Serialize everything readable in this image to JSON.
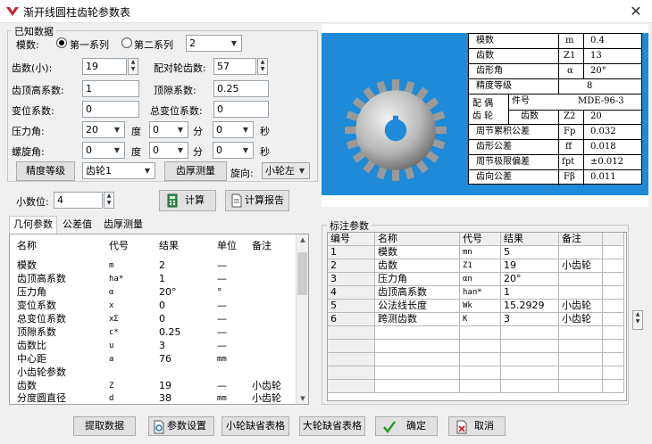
{
  "window": {
    "title": "渐开线圆柱齿轮参数表",
    "close_glyph": "✕"
  },
  "known": {
    "group_label": "已知数据",
    "modulus_label": "模数:",
    "series1_label": "第一系列",
    "series2_label": "第二系列",
    "modulus_value": "2",
    "teeth_label": "齿数(小):",
    "teeth_value": "19",
    "mating_teeth_label": "配对轮齿数:",
    "mating_teeth_value": "57",
    "addendum_label": "齿顶高系数:",
    "addendum_value": "1",
    "clearance_label": "顶隙系数:",
    "clearance_value": "0.25",
    "shift_label": "变位系数:",
    "shift_value": "0",
    "total_shift_label": "总变位系数:",
    "total_shift_value": "0",
    "pressure_label": "压力角:",
    "pressure_deg": "20",
    "pressure_min": "0",
    "pressure_sec": "0",
    "helix_label": "螺旋角:",
    "helix_deg": "0",
    "helix_min": "0",
    "helix_sec": "0",
    "unit_deg": "度",
    "unit_min": "分",
    "unit_sec": "秒",
    "precision_button": "精度等级",
    "gear_select": "齿轮1",
    "thickness_button": "齿厚测量",
    "rotation_label": "旋向:",
    "rotation_value": "小轮左"
  },
  "decimal": {
    "label": "小数位:",
    "value": "4"
  },
  "actions": {
    "calc_label": "计算",
    "report_label": "计算报告"
  },
  "spec_table": {
    "rows": [
      {
        "name": "模数",
        "sym": "m",
        "val": "0.4"
      },
      {
        "name": "齿数",
        "sym": "Z1",
        "val": "13"
      },
      {
        "name": "齿形角",
        "sym": "α",
        "val": "20°"
      },
      {
        "name": "精度等级",
        "sym": "",
        "val": "8"
      },
      {
        "name": "件号",
        "sym": "",
        "val": "MDE-96-3"
      },
      {
        "name": "齿数",
        "sym": "Z2",
        "val": "20"
      },
      {
        "name": "周节累积公差",
        "sym": "Fp",
        "val": "0.032"
      },
      {
        "name": "齿形公差",
        "sym": "ff",
        "val": "0.018"
      },
      {
        "name": "周节极限偏差",
        "sym": "fpt",
        "val": "±0.012"
      },
      {
        "name": "齿向公差",
        "sym": "Fβ",
        "val": "0.011"
      }
    ],
    "pair_label_a": "配 偶",
    "pair_label_b": "齿 轮"
  },
  "tabs": [
    "几何参数",
    "公差值",
    "齿厚测量"
  ],
  "geometry": {
    "headers": [
      "名称",
      "代号",
      "结果",
      "单位",
      "备注"
    ],
    "rows": [
      [
        "模数",
        "m",
        "2",
        "—",
        ""
      ],
      [
        "齿顶高系数",
        "ha*",
        "1",
        "—",
        ""
      ],
      [
        "压力角",
        "α",
        "20°",
        "°",
        ""
      ],
      [
        "变位系数",
        "x",
        "0",
        "—",
        ""
      ],
      [
        "总变位系数",
        "xΣ",
        "0",
        "—",
        ""
      ],
      [
        "顶隙系数",
        "c*",
        "0.25",
        "—",
        ""
      ],
      [
        "齿数比",
        "u",
        "3",
        "—",
        ""
      ],
      [
        "中心距",
        "a",
        "76",
        "mm",
        ""
      ],
      [
        "小齿轮参数",
        "",
        "",
        "",
        ""
      ],
      [
        "齿数",
        "Z",
        "19",
        "—",
        "小齿轮"
      ],
      [
        "分度圆直径",
        "d",
        "38",
        "mm",
        "小齿轮"
      ]
    ]
  },
  "annotation": {
    "group_label": "标注参数",
    "headers": [
      "编号",
      "名称",
      "代号",
      "结果",
      "备注"
    ],
    "rows": [
      [
        "1",
        "模数",
        "mn",
        "5",
        ""
      ],
      [
        "2",
        "齿数",
        "Z1",
        "19",
        "小齿轮"
      ],
      [
        "3",
        "压力角",
        "αn",
        "20°",
        ""
      ],
      [
        "4",
        "齿顶高系数",
        "han*",
        "1",
        ""
      ],
      [
        "5",
        "公法线长度",
        "Wk",
        "15.2929",
        "小齿轮"
      ],
      [
        "6",
        "跨测齿数",
        "K",
        "3",
        "小齿轮"
      ]
    ]
  },
  "footer": {
    "extract": "提取数据",
    "settings": "参数设置",
    "small_default": "小轮缺省表格",
    "large_default": "大轮缺省表格",
    "ok": "确定",
    "cancel": "取消"
  }
}
